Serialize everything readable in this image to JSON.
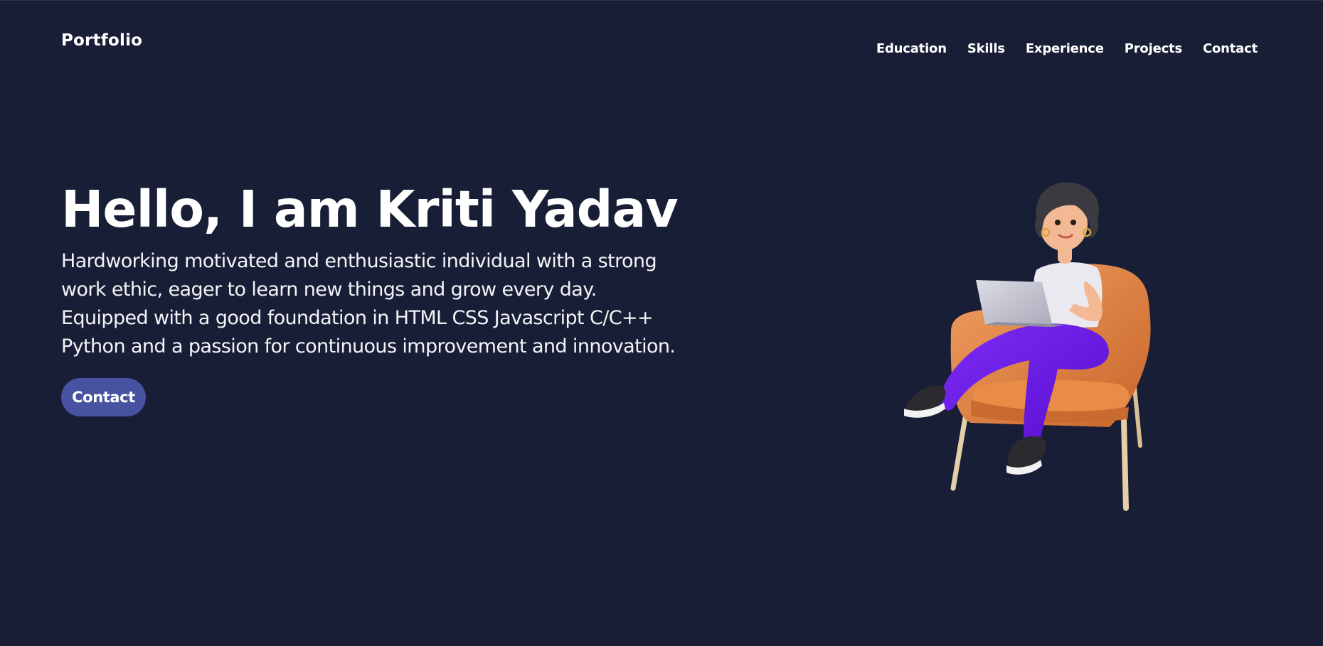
{
  "header": {
    "brand": "Portfolio",
    "nav": [
      {
        "label": "Education"
      },
      {
        "label": "Skills"
      },
      {
        "label": "Experience"
      },
      {
        "label": "Projects"
      },
      {
        "label": "Contact"
      }
    ]
  },
  "hero": {
    "title": "Hello, I am Kriti Yadav",
    "description_lines": [
      "Hardworking motivated and enthusiastic individual with a strong",
      "work ethic, eager to learn new things and grow every day.",
      "Equipped with a good foundation in HTML CSS Javascript C/C++",
      "Python and a passion for continuous improvement and innovation."
    ],
    "cta_label": "Contact"
  },
  "illustration": {
    "icon": "woman-with-laptop-in-armchair-illustration"
  },
  "colors": {
    "background": "#181e35",
    "text": "#ffffff",
    "button": "#4753a0",
    "chair": "#e0823f",
    "pants": "#6a14e8",
    "laptop": "#c7c7d3"
  }
}
